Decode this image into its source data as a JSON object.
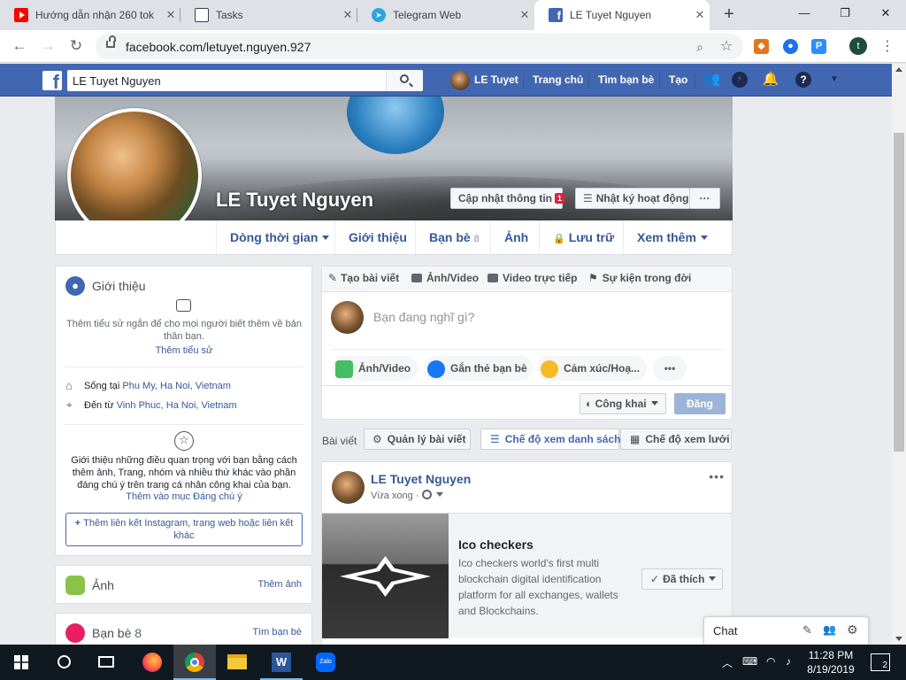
{
  "browser": {
    "tabs": [
      {
        "title": "Hướng dẫn nhận 260 tok",
        "icon": "youtube-icon",
        "color": "#ff0000"
      },
      {
        "title": "Tasks",
        "icon": "flag-icon",
        "color": "#3c4043"
      },
      {
        "title": "Telegram Web",
        "icon": "telegram-icon",
        "color": "#2ca5e0"
      },
      {
        "title": "LE Tuyet Nguyen",
        "icon": "facebook-icon",
        "color": "#4267b2"
      }
    ],
    "url": "facebook.com/letuyet.nguyen.927",
    "profile_initial": "t"
  },
  "fb": {
    "search_value": "LE Tuyet Nguyen",
    "nav": {
      "user": "LE Tuyet",
      "home": "Trang chủ",
      "find_friends": "Tìm bạn bè",
      "create": "Tạo"
    }
  },
  "profile": {
    "name": "LE Tuyet Nguyen",
    "update_info": "Cập nhật thông tin",
    "update_badge": "1",
    "activity_log": "Nhật ký hoạt động",
    "more_dots": "···",
    "tabs": {
      "timeline": "Dòng thời gian",
      "about": "Giới thiệu",
      "friends": "Bạn bè",
      "friends_count": "8",
      "photos": "Ảnh",
      "archive": "Lưu trữ",
      "more": "Xem thêm"
    }
  },
  "intro": {
    "title": "Giới thiệu",
    "bio_prompt": "Thêm tiểu sử ngắn để cho mọi người biết thêm về bản thân bạn.",
    "add_bio": "Thêm tiểu sử",
    "lives_prefix": "Sống tại ",
    "lives": "Phu My, Ha Noi, Vietnam",
    "from_prefix": "Đến từ ",
    "from": "Vinh Phuc, Ha Noi, Vietnam",
    "featured_text": "Giới thiệu những điều quan trọng với bạn bằng cách thêm ảnh, Trang, nhóm và nhiều thứ khác vào phần đáng chú ý trên trang cá nhân công khai của bạn.",
    "featured_link": "Thêm vào mục Đáng chú ý",
    "add_links": "Thêm liên kết Instagram, trang web hoặc liên kết khác"
  },
  "photos_card": {
    "title": "Ảnh",
    "action": "Thêm ảnh"
  },
  "friends_card": {
    "title": "Bạn bè",
    "count": "8",
    "action": "Tìm bạn bè"
  },
  "composer": {
    "tab_create": "Tạo bài viết",
    "tab_photo": "Ảnh/Video",
    "tab_live": "Video trực tiếp",
    "tab_event": "Sự kiện trong đời",
    "placeholder": "Bạn đang nghĩ gì?",
    "opt_photo": "Ảnh/Video",
    "opt_tag": "Gắn thẻ bạn bè",
    "opt_feeling": "Cảm xúc/Hoạ...",
    "privacy": "Công khai",
    "post_button": "Đăng"
  },
  "posts_bar": {
    "label": "Bài viết",
    "manage": "Quản lý bài viết",
    "list_view": "Chế độ xem danh sách",
    "grid_view": "Chế độ xem lưới"
  },
  "post": {
    "author": "LE Tuyet Nguyen",
    "time": "Vừa xong",
    "page_title": "Ico checkers",
    "page_desc": "Ico checkers world's first multi blockchain digital identification platform for all exchanges, wallets and Blockchains.",
    "liked": "Đã thích"
  },
  "chat": {
    "label": "Chat"
  },
  "taskbar": {
    "time": "11:28 PM",
    "date": "8/19/2019",
    "notifications": "2",
    "apps": [
      "windows-start-icon",
      "search-circle-icon",
      "task-view-icon",
      "firefox-icon",
      "chrome-icon",
      "file-explorer-icon",
      "word-icon",
      "zalo-icon"
    ]
  },
  "colors": {
    "fb_blue": "#4267b2",
    "link": "#385898",
    "red_badge": "#e41e3f"
  }
}
